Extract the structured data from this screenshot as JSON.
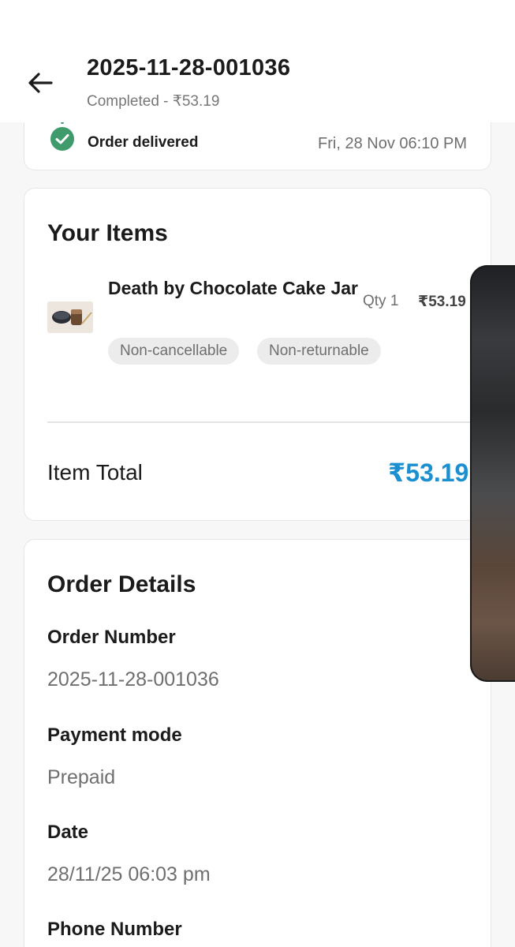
{
  "header": {
    "title": "2025-11-28-001036",
    "subtitle": "Completed - ₹53.19"
  },
  "status": {
    "label": "Order delivered",
    "time": "Fri, 28 Nov 06:10 PM",
    "icon": "check-circle-icon",
    "color": "#3f9b6b"
  },
  "items_section": {
    "title": "Your Items",
    "items": [
      {
        "name": "Death by Chocolate Cake Jar",
        "qty": "Qty 1",
        "price": "₹53.19",
        "tags": [
          "Non-cancellable",
          "Non-returnable"
        ]
      }
    ],
    "total_label": "Item Total",
    "total_value": "₹53.19",
    "total_color": "#1b8fd0"
  },
  "details_section": {
    "title": "Order Details",
    "fields": [
      {
        "label": "Order Number",
        "value": "2025-11-28-001036"
      },
      {
        "label": "Payment mode",
        "value": "Prepaid"
      },
      {
        "label": "Date",
        "value": "28/11/25 06:03 pm"
      },
      {
        "label": "Phone Number",
        "value": ""
      }
    ]
  }
}
